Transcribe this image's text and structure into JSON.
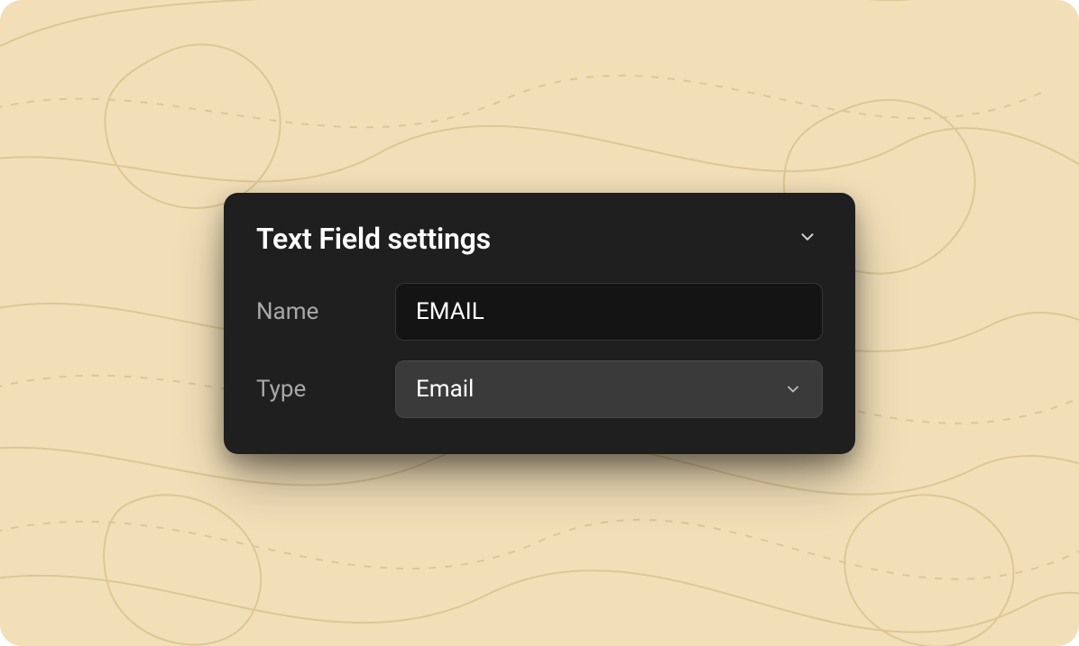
{
  "panel": {
    "title": "Text Field settings",
    "fields": {
      "name": {
        "label": "Name",
        "value": "EMAIL"
      },
      "type": {
        "label": "Type",
        "selected": "Email"
      }
    }
  },
  "colors": {
    "background": "#f2dfb8",
    "panel": "#1f1f1f",
    "inputBg": "#141414",
    "selectBg": "#3a3a3a",
    "textPrimary": "#ffffff",
    "textMuted": "#a8a8a8"
  }
}
